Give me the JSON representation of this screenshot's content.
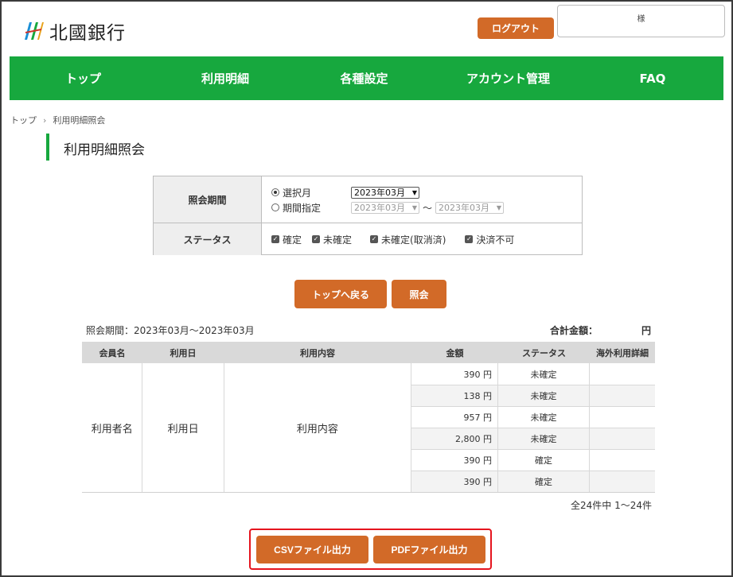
{
  "header": {
    "bank_name": "北國銀行",
    "logout_label": "ログアウト",
    "user_suffix": "様"
  },
  "nav": {
    "items": [
      "トップ",
      "利用明細",
      "各種設定",
      "アカウント管理",
      "FAQ"
    ]
  },
  "breadcrumb": {
    "home": "トップ",
    "separator": "›",
    "current": "利用明細照会"
  },
  "page": {
    "title": "利用明細照会"
  },
  "filter": {
    "period_label": "照会期間",
    "radio_month_label": "選択月",
    "radio_range_label": "期間指定",
    "month_value": "2023年03月",
    "range_from_value": "2023年03月",
    "range_to_value": "2023年03月",
    "range_sep": "～",
    "status_label": "ステータス",
    "statuses": [
      "確定",
      "未確定",
      "未確定(取消済)",
      "決済不可"
    ]
  },
  "actions": {
    "back_label": "トップへ戻る",
    "search_label": "照会"
  },
  "results": {
    "period_text": "照会期間：2023年03月～2023年03月",
    "total_label": "合計金額：",
    "total_unit": "円",
    "columns": [
      "会員名",
      "利用日",
      "利用内容",
      "金額",
      "ステータス",
      "海外利用詳細"
    ],
    "merged_member": "利用者名",
    "merged_date": "利用日",
    "merged_content": "利用内容",
    "rows": [
      {
        "amount": "390 円",
        "status": "未確定"
      },
      {
        "amount": "138 円",
        "status": "未確定"
      },
      {
        "amount": "957 円",
        "status": "未確定"
      },
      {
        "amount": "2,800 円",
        "status": "未確定"
      },
      {
        "amount": "390 円",
        "status": "確定"
      },
      {
        "amount": "390 円",
        "status": "確定"
      }
    ],
    "count_text": "全24件中 1～24件"
  },
  "export": {
    "csv_label": "CSVファイル出力",
    "pdf_label": "PDFファイル出力"
  },
  "colors": {
    "nav_green": "#17a83e",
    "button_orange": "#d26a28",
    "highlight_red": "#e5141e"
  }
}
